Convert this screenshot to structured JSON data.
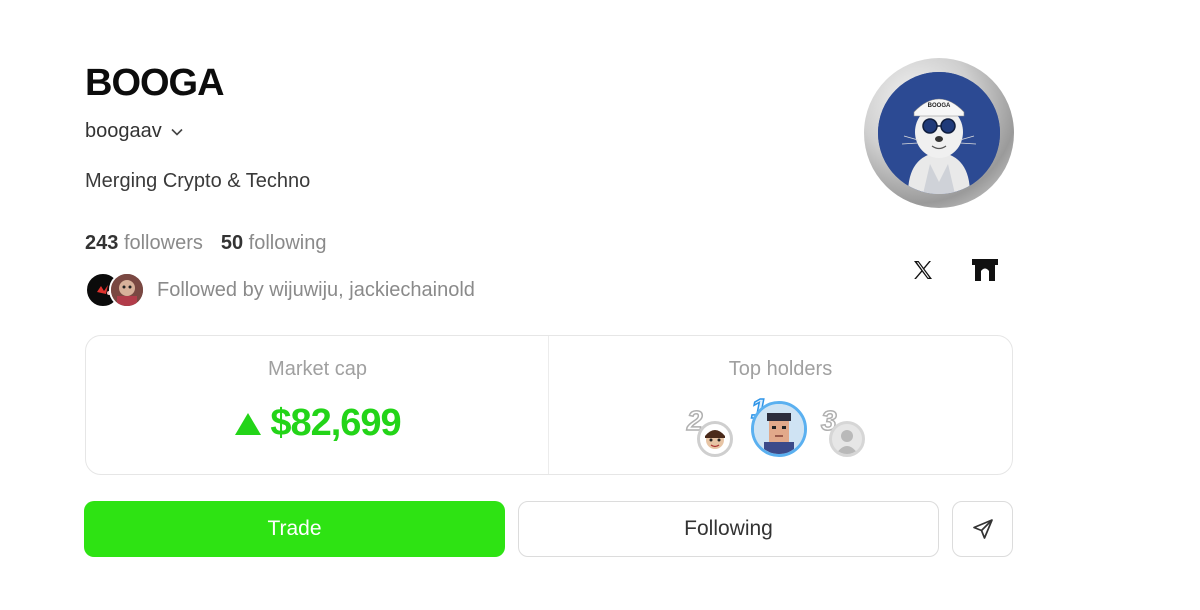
{
  "profile": {
    "name": "BOOGA",
    "handle": "boogaav",
    "bio": "Merging Crypto & Techno",
    "avatar_badge_text": "BOOGA"
  },
  "stats": {
    "followers_count": "243",
    "followers_label": "followers",
    "following_count": "50",
    "following_label": "following"
  },
  "followed_by": {
    "text": "Followed by wijuwiju, jackiechainold"
  },
  "social": {
    "x_icon": "x-logo-icon",
    "second_icon": "gate-logo-icon"
  },
  "market": {
    "label": "Market cap",
    "value": "$82,699",
    "trend": "up",
    "trend_color": "#23d418"
  },
  "top_holders": {
    "label": "Top holders",
    "ranks": [
      "2",
      "1",
      "3"
    ]
  },
  "actions": {
    "trade_label": "Trade",
    "following_label": "Following",
    "share_icon": "send-icon"
  },
  "colors": {
    "accent_green": "#2ee313",
    "avatar_bg": "#2c4a93"
  }
}
